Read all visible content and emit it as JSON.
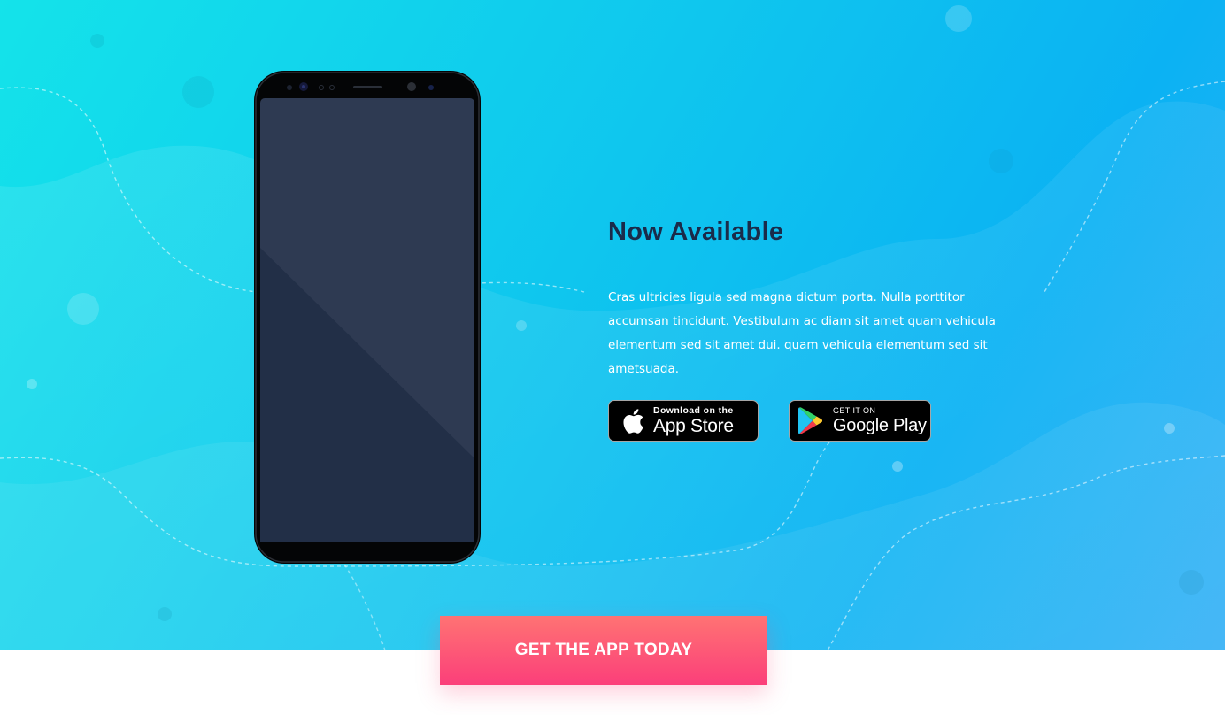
{
  "hero": {
    "title": "Now Available",
    "description": "Cras ultricies ligula sed magna dictum porta. Nulla porttitor accumsan tincidunt. Vestibulum ac diam sit amet quam vehicula elementum sed sit amet dui. quam vehicula elementum sed sit ametsuada."
  },
  "stores": {
    "apple": {
      "small": "Download on the",
      "big": "App Store",
      "icon": "apple-icon"
    },
    "google": {
      "small": "GET IT ON",
      "big": "Google Play",
      "icon": "google-play-icon"
    }
  },
  "cta": {
    "label": "GET THE APP TODAY"
  },
  "colors": {
    "title": "#1a2b4a",
    "cta_top": "#ff7373",
    "cta_bottom": "#fb3f7a",
    "hero_start": "#14e3ea",
    "hero_end": "#30aff6"
  }
}
